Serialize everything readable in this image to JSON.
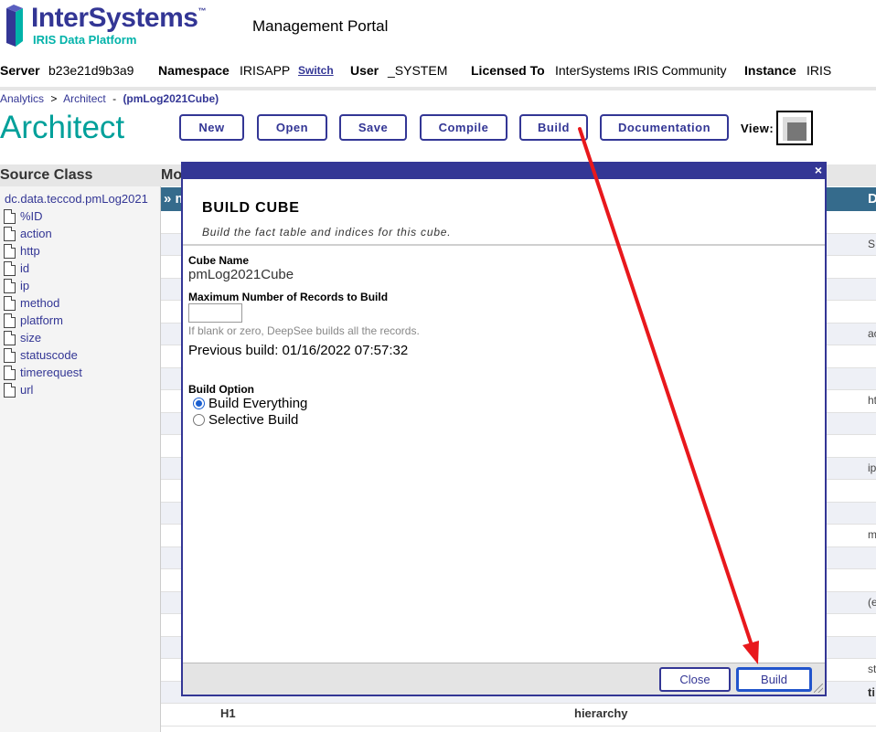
{
  "brand": {
    "name": "InterSystems",
    "tm": "™",
    "subtitle": "IRIS Data Platform",
    "portal_title": "Management Portal"
  },
  "infobar": {
    "server_label": "Server",
    "server_value": "b23e21d9b3a9",
    "namespace_label": "Namespace",
    "namespace_value": "IRISAPP",
    "switch_link": "Switch",
    "user_label": "User",
    "user_value": "_SYSTEM",
    "licensed_label": "Licensed To",
    "licensed_value": "InterSystems IRIS Community",
    "instance_label": "Instance",
    "instance_value": "IRIS"
  },
  "breadcrumb": {
    "analytics": "Analytics",
    "sep": ">",
    "architect": "Architect",
    "dash": "-",
    "cube": "(pmLog2021Cube)"
  },
  "page_title": "Architect",
  "toolbar": {
    "new": "New",
    "open": "Open",
    "save": "Save",
    "compile": "Compile",
    "build": "Build",
    "documentation": "Documentation",
    "view_label": "View:"
  },
  "source_class": {
    "header": "Source Class",
    "class_name": "dc.data.teccod.pmLog2021",
    "items": [
      "%ID",
      "action",
      "http",
      "id",
      "ip",
      "method",
      "platform",
      "size",
      "statuscode",
      "timerequest",
      "url"
    ]
  },
  "model_panel": {
    "header": "Mo",
    "bar_left": "» m",
    "bar_right": "D",
    "right_snippets": [
      "S",
      "ac",
      "ht",
      "ip",
      "m",
      "(e",
      "st",
      "ti"
    ],
    "row_name": "H1",
    "row_type": "hierarchy"
  },
  "modal": {
    "close_glyph": "×",
    "title": "BUILD CUBE",
    "subtitle": "Build the fact table and indices for this cube.",
    "cube_name_label": "Cube Name",
    "cube_name_value": "pmLog2021Cube",
    "max_records_label": "Maximum Number of Records to Build",
    "max_records_value": "",
    "max_records_hint": "If blank or zero, DeepSee builds all the records.",
    "previous_build": "Previous build: 01/16/2022 07:57:32",
    "build_option_label": "Build Option",
    "options": [
      {
        "label": "Build Everything",
        "selected": true
      },
      {
        "label": "Selective Build",
        "selected": false
      }
    ],
    "close_button": "Close",
    "build_button": "Build"
  },
  "colors": {
    "brand_navy": "#333695",
    "brand_teal": "#00a09a",
    "annotation_arrow": "#e8181c"
  }
}
